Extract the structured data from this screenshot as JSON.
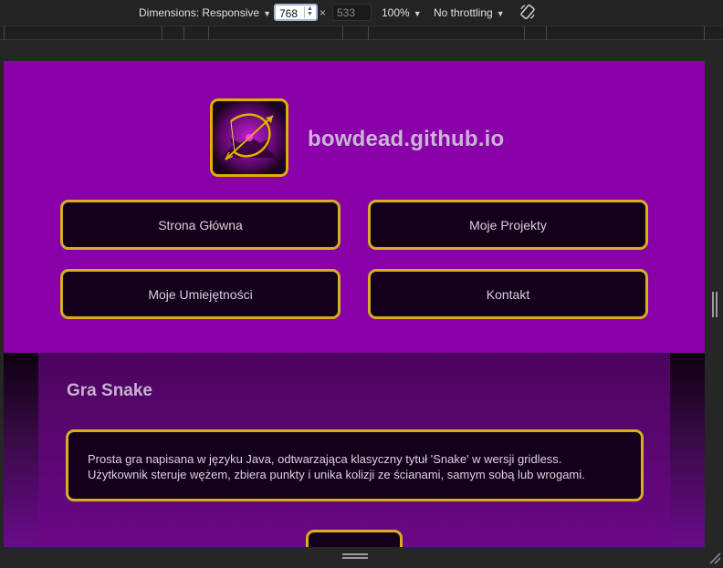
{
  "devtools": {
    "dimensions_label": "Dimensions: Responsive",
    "width_value": "768",
    "height_value": "533",
    "times": "×",
    "zoom": "100%",
    "throttling": "No throttling",
    "rotate_icon": "rotate-icon"
  },
  "site": {
    "title": "bowdead.github.io",
    "logo_icon": "bow-arrow-logo",
    "nav": [
      {
        "label": "Strona Główna"
      },
      {
        "label": "Moje Projekty"
      },
      {
        "label": "Moje Umiejętności"
      },
      {
        "label": "Kontakt"
      }
    ]
  },
  "project": {
    "title": "Gra Snake",
    "description_line1": "Prosta gra napisana w języku Java, odtwarzająca klasyczny tytuł 'Snake' w wersji gridless.",
    "description_line2": "Użytkownik steruje wężem, zbiera punkty i unika kolizji ze ścianami, samym sobą lub wrogami."
  },
  "colors": {
    "header_bg": "#8a00a8",
    "button_bg": "#15001c",
    "button_border": "#d4b01e"
  }
}
